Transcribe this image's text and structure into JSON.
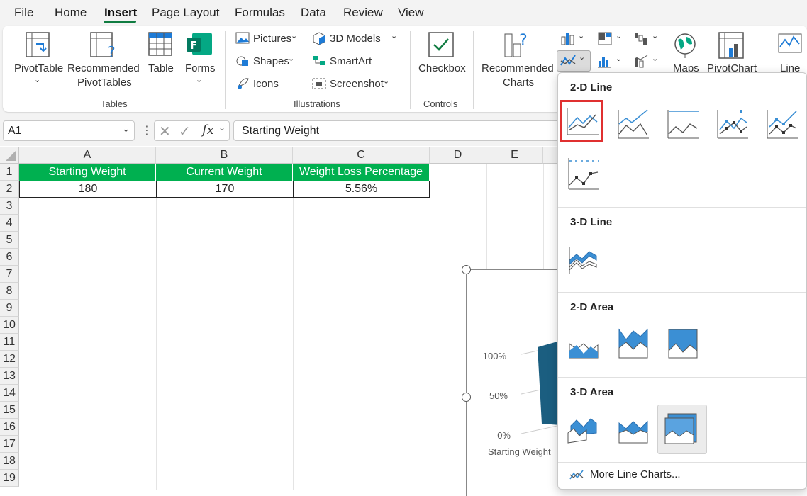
{
  "menu": {
    "tabs": [
      "File",
      "Home",
      "Insert",
      "Page Layout",
      "Formulas",
      "Data",
      "Review",
      "View"
    ],
    "active": "Insert"
  },
  "ribbon": {
    "pivottable": "PivotTable",
    "rec_pivot_1": "Recommended",
    "rec_pivot_2": "PivotTables",
    "table": "Table",
    "forms": "Forms",
    "group_tables": "Tables",
    "pictures": "Pictures",
    "shapes": "Shapes",
    "icons": "Icons",
    "models3d": "3D Models",
    "smartart": "SmartArt",
    "screenshot": "Screenshot",
    "group_illustrations": "Illustrations",
    "checkbox": "Checkbox",
    "group_controls": "Controls",
    "rec_charts_1": "Recommended",
    "rec_charts_2": "Charts",
    "maps": "Maps",
    "pivotchart": "PivotChart",
    "line": "Line"
  },
  "formula_bar": {
    "name_box": "A1",
    "fx": "fx",
    "formula": "Starting Weight"
  },
  "columns": [
    "A",
    "B",
    "C",
    "D",
    "E"
  ],
  "rows": [
    "1",
    "2",
    "3",
    "4",
    "5",
    "6",
    "7",
    "8",
    "9",
    "10",
    "11",
    "12",
    "13",
    "14",
    "15",
    "16",
    "17",
    "18",
    "19"
  ],
  "table": {
    "headers": [
      "Starting Weight",
      "Current Weight",
      "Weight Loss Percentage"
    ],
    "values": [
      "180",
      "170",
      "5.56%"
    ]
  },
  "chart": {
    "y_ticks": [
      "100%",
      "50%",
      "0%"
    ],
    "x_label": "Starting Weight",
    "bar_color": "#1b5e80"
  },
  "dropdown": {
    "sec_2d_line": "2-D Line",
    "sec_3d_line": "3-D Line",
    "sec_2d_area": "2-D Area",
    "sec_3d_area": "3-D Area",
    "more": "More Line Charts..."
  },
  "colors": {
    "header_fill": "#00b050",
    "accent": "#107c41",
    "selection_red": "#e03030",
    "chart_blue": "#3b8fd4"
  }
}
